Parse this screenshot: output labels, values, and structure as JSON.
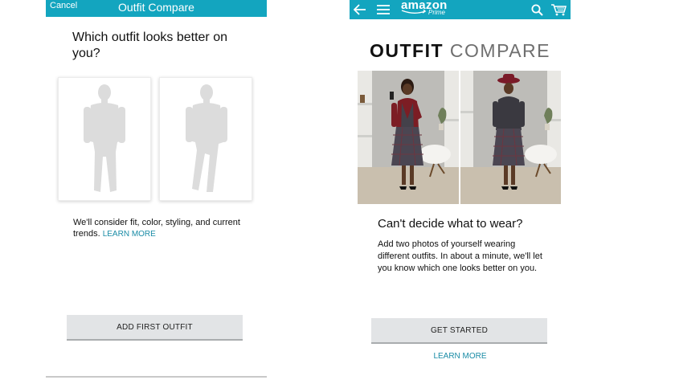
{
  "left_screen": {
    "cancel_label": "Cancel",
    "title": "Outfit Compare",
    "question": "Which outfit looks better on you?",
    "placeholders": [
      {
        "icon": "man-silhouette-icon"
      },
      {
        "icon": "man-silhouette-crossed-legs-icon"
      }
    ],
    "consider_text": "We'll consider fit, color, styling, and current trends.",
    "learn_more_label": "LEARN MORE",
    "add_button_label": "ADD FIRST OUTFIT"
  },
  "right_screen": {
    "nav": {
      "back_icon": "back-arrow-icon",
      "menu_icon": "hamburger-menu-icon",
      "logo_text": "amazon",
      "logo_sub": "Prime",
      "search_icon": "search-icon",
      "cart_icon": "cart-icon"
    },
    "hero_title_bold": "OUTFIT",
    "hero_title_light": "COMPARE",
    "photos": [
      {
        "description_icon": "outfit-photo-red-jacket"
      },
      {
        "description_icon": "outfit-photo-red-hat"
      }
    ],
    "heading": "Can't decide what to wear?",
    "body": "Add two photos of yourself wearing different outfits. In about a minute, we'll let you know which one looks better on you.",
    "cta_label": "GET STARTED",
    "learn_more_label": "LEARN MORE"
  },
  "colors": {
    "brand_teal": "#13a5bf",
    "link_blue": "#1a8ca6",
    "button_gray": "#e2e4e6"
  }
}
